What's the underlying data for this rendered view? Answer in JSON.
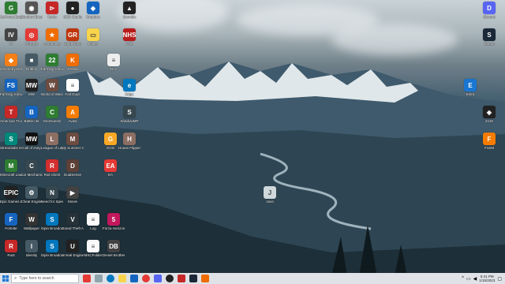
{
  "icons": [
    {
      "label": "GeForce Experience",
      "color": "#2e7d32",
      "sym": "G"
    },
    {
      "label": "Shadow Blast",
      "color": "#555",
      "sym": "◉"
    },
    {
      "label": "Tyche",
      "color": "#c62828",
      "sym": "⊳"
    },
    {
      "label": "OBS Studio",
      "color": "#222",
      "sym": "●"
    },
    {
      "label": "Dropbox",
      "color": "#1565c0",
      "sym": "◆"
    },
    {
      "label": "Stumble",
      "color": "#222",
      "sym": "▲"
    },
    {
      "label": "Discord",
      "color": "#5865f2",
      "sym": "D"
    },
    {
      "label": "IV",
      "color": "#444",
      "sym": "IV"
    },
    {
      "label": "Chrome",
      "color": "#e53935",
      "sym": "◎"
    },
    {
      "label": "Among Us",
      "color": "#ef6c00",
      "sym": "★"
    },
    {
      "label": "Gold Rush",
      "color": "#bf360c",
      "sym": "GR"
    },
    {
      "label": "Folder",
      "color": "#f9d44a",
      "sym": "▭"
    },
    {
      "label": "NHS",
      "color": "#b71c1c",
      "sym": "NHS"
    },
    {
      "label": "Steam",
      "color": "#1b2838",
      "sym": "S"
    },
    {
      "label": "Geometry Dash",
      "color": "#f57f17",
      "sym": "◆"
    },
    {
      "label": "Roblox",
      "color": "#455a64",
      "sym": "■"
    },
    {
      "label": "Farming Simulator 22",
      "color": "#2e7d32",
      "sym": "22"
    },
    {
      "label": "Kerbal",
      "color": "#ef6c00",
      "sym": "K"
    },
    {
      "label": "Doc",
      "color": "#eee",
      "sym": "≡"
    },
    {
      "label": "Farming Simulator 22",
      "color": "#1565c0",
      "sym": "FS"
    },
    {
      "label": "MW",
      "color": "#222",
      "sym": "MW"
    },
    {
      "label": "World of Warcraft",
      "color": "#6d4c41",
      "sym": "W"
    },
    {
      "label": "Fall Guys",
      "color": "#fff",
      "sym": "≡"
    },
    {
      "label": "Edge",
      "color": "#0277bd",
      "sym": "e"
    },
    {
      "label": "Entra",
      "color": "#1976d2",
      "sym": "E"
    },
    {
      "label": "American Truck Simulator",
      "color": "#c62828",
      "sym": "T"
    },
    {
      "label": "Battle.net",
      "color": "#1565c0",
      "sym": "B"
    },
    {
      "label": "GeoGuessr",
      "color": "#2e7d32",
      "sym": "C"
    },
    {
      "label": "Avast",
      "color": "#f57c00",
      "sym": "A"
    },
    {
      "label": "ShadowMP",
      "color": "#37474f",
      "sym": "S"
    },
    {
      "label": "iCUE",
      "color": "#222",
      "sym": "◈"
    },
    {
      "label": "Streamlabs OBS",
      "color": "#00897b",
      "sym": "S"
    },
    {
      "label": "Call of Duty",
      "color": "#111",
      "sym": "MW"
    },
    {
      "label": "League of Legends",
      "color": "#8d6e63",
      "sym": "L"
    },
    {
      "label": "My Summer Car",
      "color": "#6d4c41",
      "sym": "M"
    },
    {
      "label": "GOG",
      "color": "#f9a825",
      "sym": "G"
    },
    {
      "label": "House Flipper",
      "color": "#8d6e63",
      "sym": "H"
    },
    {
      "label": "FiveM",
      "color": "#f57c00",
      "sym": "F"
    },
    {
      "label": "Minecraft Launcher",
      "color": "#2e7d32",
      "sym": "M"
    },
    {
      "label": "Car Mechanic",
      "color": "#37474f",
      "sym": "C"
    },
    {
      "label": "Riot Client",
      "color": "#d32f2f",
      "sym": "R"
    },
    {
      "label": "DualSense",
      "color": "#5d4037",
      "sym": "D"
    },
    {
      "label": "EA",
      "color": "#e53935",
      "sym": "EA"
    },
    {
      "label": "Epic Games Launcher",
      "color": "#222",
      "sym": "EPIC"
    },
    {
      "label": "Cheat Engine",
      "color": "#455a64",
      "sym": "⚙"
    },
    {
      "label": "Need for Speed",
      "color": "#37474f",
      "sym": "N"
    },
    {
      "label": "Movie",
      "color": "#424242",
      "sym": "▶"
    },
    {
      "label": "Java",
      "color": "#cfd8dc",
      "sym": "J"
    },
    {
      "label": "Fortnite",
      "color": "#1565c0",
      "sym": "F"
    },
    {
      "label": "Wallpaper",
      "color": "#333",
      "sym": "W"
    },
    {
      "label": "iSpin Broadcaster",
      "color": "#0277bd",
      "sym": "S"
    },
    {
      "label": "Grand Theft Auto V",
      "color": "#263238",
      "sym": "V"
    },
    {
      "label": "Log",
      "color": "#fafafa",
      "sym": "≡"
    },
    {
      "label": "Forza Horizon 5",
      "color": "#c2185b",
      "sym": "5"
    },
    {
      "label": "Rust",
      "color": "#c62828",
      "sym": "R"
    },
    {
      "label": "Identity",
      "color": "#455a64",
      "sym": "I"
    },
    {
      "label": "iSpin Broadcast",
      "color": "#0277bd",
      "sym": "S"
    },
    {
      "label": "Unreal Engine",
      "color": "#222",
      "sym": "U"
    },
    {
      "label": "MSCFolder",
      "color": "#fafafa",
      "sym": "≡"
    },
    {
      "label": "Diesel Brothers",
      "color": "#424242",
      "sym": "DB"
    }
  ],
  "taskbar": {
    "search_placeholder": "Type here to search",
    "time": "5:41 PM",
    "date": "1/15/2023"
  }
}
